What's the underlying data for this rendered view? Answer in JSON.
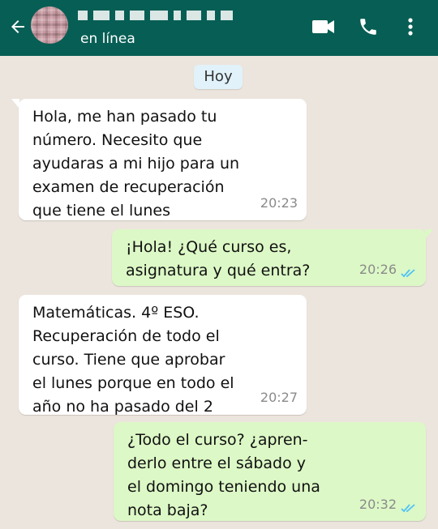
{
  "header": {
    "status": "en línea",
    "icons": [
      "back-arrow-icon",
      "video-call-icon",
      "phone-icon",
      "more-vert-icon"
    ]
  },
  "chat": {
    "date_label": "Hoy",
    "messages": [
      {
        "direction": "in",
        "text": "Hola, me han pasado tu\nnúmero. Necesito que\nayudaras a mi hijo para un\nexamen de recuperación\nque tiene el lunes",
        "time": "20:23"
      },
      {
        "direction": "out",
        "text": "¡Hola! ¿Qué curso es,\nasignatura y qué entra?",
        "time": "20:26",
        "read": true
      },
      {
        "direction": "in",
        "text": "Matemáticas. 4º ESO.\nRecuperación de todo el\ncurso. Tiene que aprobar\nel lunes porque en todo el\naño no ha pasado del 2",
        "time": "20:27"
      },
      {
        "direction": "out",
        "text": "¿Todo el curso? ¿apren-\nderlo entre el sábado y\nel domingo teniendo una\nnota baja?",
        "time": "20:32",
        "read": true
      }
    ]
  },
  "colors": {
    "header": "#075e54",
    "background": "#ece5dd",
    "incoming": "#ffffff",
    "outgoing": "#dcf8c6",
    "read_ticks": "#4fc3f7"
  }
}
